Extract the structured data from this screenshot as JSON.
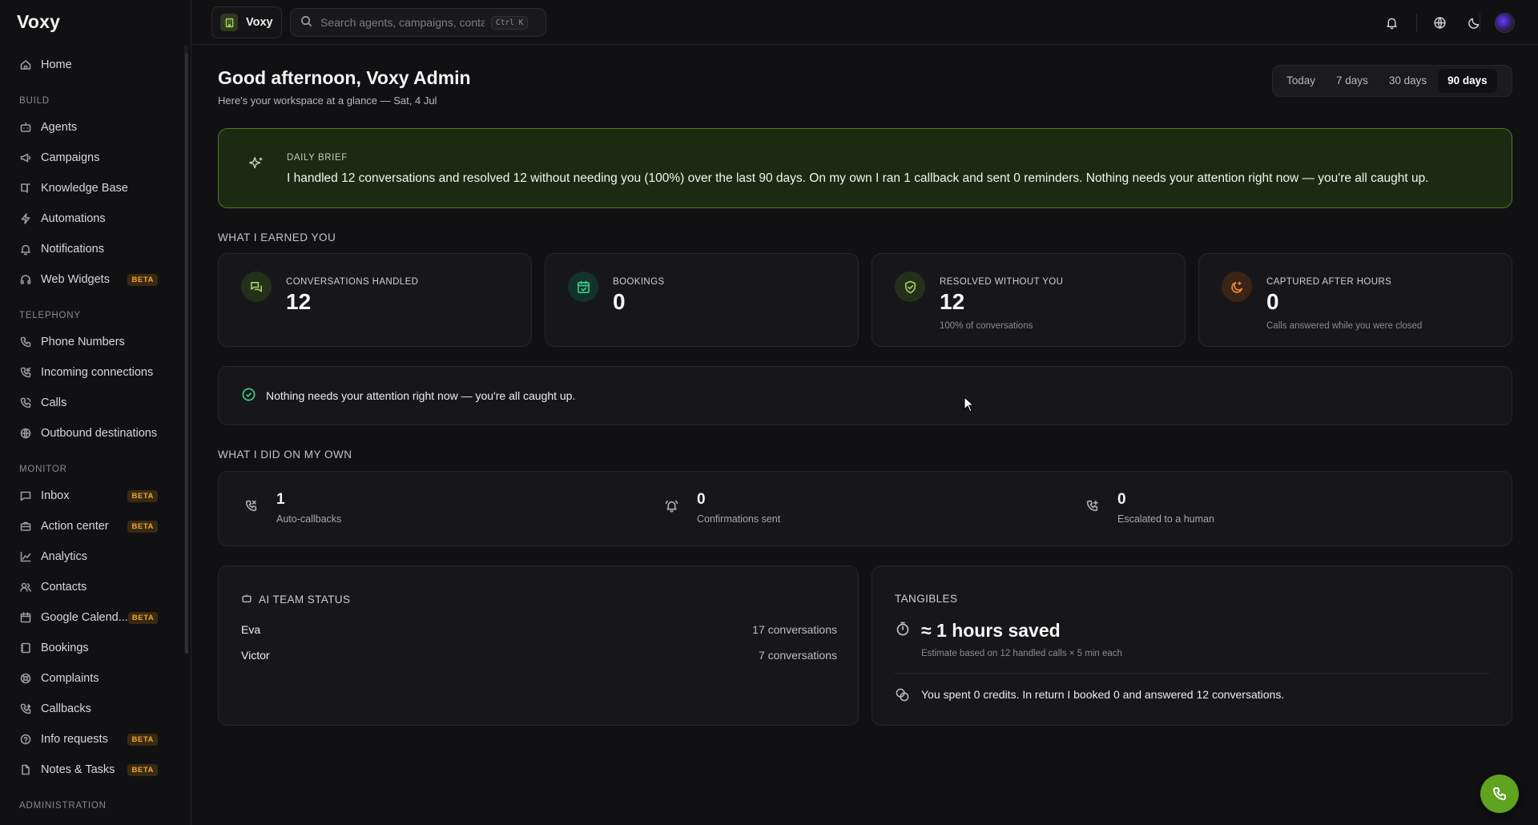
{
  "app": {
    "logo": "Voxy"
  },
  "sidebar": {
    "items_home": [
      {
        "label": "Home",
        "icon": "home-icon"
      }
    ],
    "sections": [
      {
        "title": "BUILD",
        "items": [
          {
            "label": "Agents",
            "icon": "bot-icon"
          },
          {
            "label": "Campaigns",
            "icon": "megaphone-icon"
          },
          {
            "label": "Knowledge Base",
            "icon": "book-icon"
          },
          {
            "label": "Automations",
            "icon": "bolt-icon"
          },
          {
            "label": "Notifications",
            "icon": "bell-icon"
          },
          {
            "label": "Web Widgets",
            "icon": "headset-icon",
            "badge": "BETA"
          }
        ]
      },
      {
        "title": "TELEPHONY",
        "items": [
          {
            "label": "Phone Numbers",
            "icon": "phone-icon"
          },
          {
            "label": "Incoming connections",
            "icon": "phone-incoming-icon"
          },
          {
            "label": "Calls",
            "icon": "phone-call-icon"
          },
          {
            "label": "Outbound destinations",
            "icon": "globe-icon"
          }
        ]
      },
      {
        "title": "MONITOR",
        "items": [
          {
            "label": "Inbox",
            "icon": "message-icon",
            "badge": "BETA"
          },
          {
            "label": "Action center",
            "icon": "briefcase-icon",
            "badge": "BETA"
          },
          {
            "label": "Analytics",
            "icon": "chart-icon"
          },
          {
            "label": "Contacts",
            "icon": "users-icon"
          },
          {
            "label": "Google Calend...",
            "icon": "calendar-icon",
            "badge": "BETA"
          },
          {
            "label": "Bookings",
            "icon": "notebook-icon"
          },
          {
            "label": "Complaints",
            "icon": "lifebuoy-icon"
          },
          {
            "label": "Callbacks",
            "icon": "phone-forward-icon"
          },
          {
            "label": "Info requests",
            "icon": "help-circle-icon",
            "badge": "BETA"
          },
          {
            "label": "Notes & Tasks",
            "icon": "file-icon",
            "badge": "BETA"
          }
        ]
      },
      {
        "title": "ADMINISTRATION",
        "items": []
      }
    ]
  },
  "topbar": {
    "workspace": "Voxy",
    "search_placeholder": "Search agents, campaigns, contacts",
    "shortcut": "Ctrl K"
  },
  "main": {
    "greeting": "Good afternoon, Voxy Admin",
    "subtitle": "Here's your workspace at a glance — Sat, 4 Jul",
    "range": [
      "Today",
      "7 days",
      "30 days",
      "90 days"
    ],
    "range_active": "90 days",
    "brief": {
      "title": "DAILY BRIEF",
      "text": "I handled 12 conversations and resolved 12 without needing you (100%) over the last 90 days. On my own I ran 1 callback and sent 0 reminders. Nothing needs your attention right now — you're all caught up."
    },
    "earned_title": "WHAT I EARNED YOU",
    "kpis": [
      {
        "label": "CONVERSATIONS HANDLED",
        "value": "12",
        "sub": "",
        "icon": "chat-icon",
        "color": "#a3d45a",
        "bg": "#24301a"
      },
      {
        "label": "BOOKINGS",
        "value": "0",
        "sub": "",
        "icon": "calendar-check-icon",
        "color": "#3ccf93",
        "bg": "#12332a"
      },
      {
        "label": "RESOLVED WITHOUT YOU",
        "value": "12",
        "sub": "100% of conversations",
        "icon": "shield-check-icon",
        "color": "#a3d45a",
        "bg": "#24301a"
      },
      {
        "label": "CAPTURED AFTER HOURS",
        "value": "0",
        "sub": "Calls answered while you were closed",
        "icon": "moon-icon",
        "color": "#f08a3a",
        "bg": "#3a2416"
      }
    ],
    "alert": "Nothing needs your attention right now — you're all caught up.",
    "own_title": "WHAT I DID ON MY OWN",
    "own": [
      {
        "value": "1",
        "label": "Auto-callbacks",
        "icon": "phone-callback-icon"
      },
      {
        "value": "0",
        "label": "Confirmations sent",
        "icon": "bell-ring-icon"
      },
      {
        "value": "0",
        "label": "Escalated to a human",
        "icon": "phone-transfer-icon"
      }
    ],
    "team": {
      "title": "AI TEAM STATUS",
      "rows": [
        {
          "name": "Eva",
          "count": "17 conversations"
        },
        {
          "name": "Victor",
          "count": "7 conversations"
        }
      ]
    },
    "tangibles": {
      "title": "TANGIBLES",
      "hours": "≈ 1 hours saved",
      "hours_sub": "Estimate based on 12 handled calls × 5 min each",
      "credits": "You spent 0 credits. In return I booked 0 and answered 12 conversations."
    }
  }
}
